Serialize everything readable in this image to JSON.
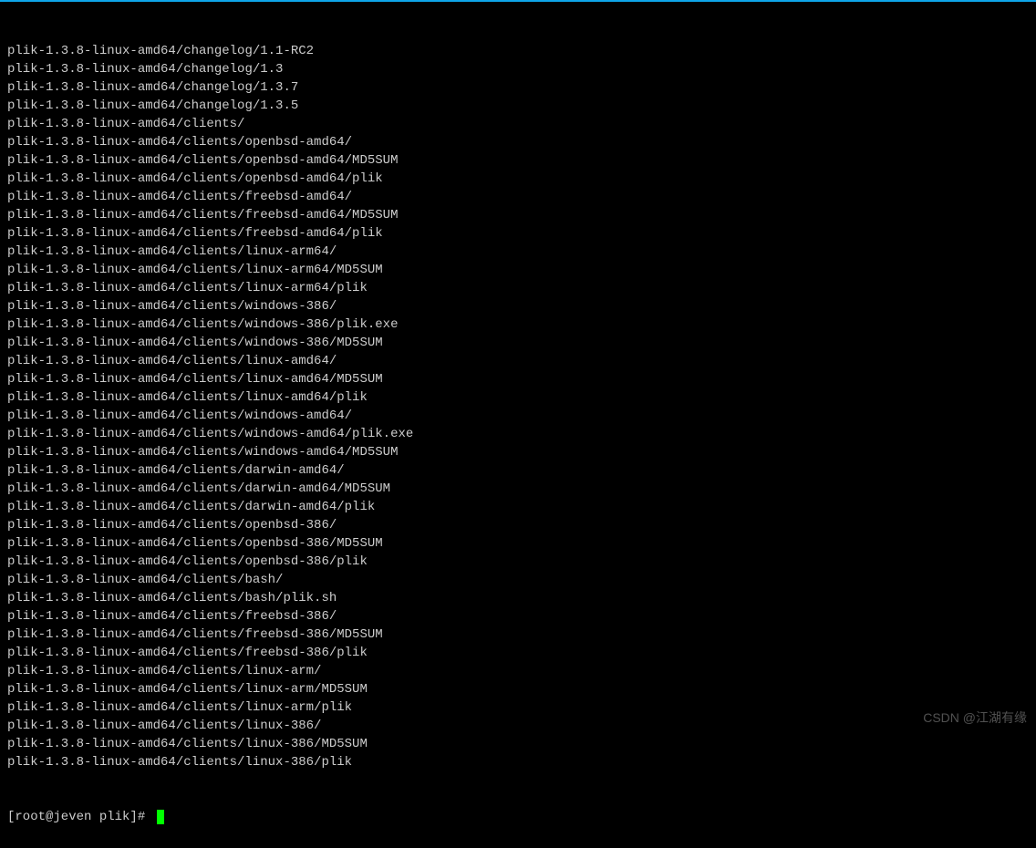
{
  "lines": [
    "plik-1.3.8-linux-amd64/changelog/1.1-RC2",
    "plik-1.3.8-linux-amd64/changelog/1.3",
    "plik-1.3.8-linux-amd64/changelog/1.3.7",
    "plik-1.3.8-linux-amd64/changelog/1.3.5",
    "plik-1.3.8-linux-amd64/clients/",
    "plik-1.3.8-linux-amd64/clients/openbsd-amd64/",
    "plik-1.3.8-linux-amd64/clients/openbsd-amd64/MD5SUM",
    "plik-1.3.8-linux-amd64/clients/openbsd-amd64/plik",
    "plik-1.3.8-linux-amd64/clients/freebsd-amd64/",
    "plik-1.3.8-linux-amd64/clients/freebsd-amd64/MD5SUM",
    "plik-1.3.8-linux-amd64/clients/freebsd-amd64/plik",
    "plik-1.3.8-linux-amd64/clients/linux-arm64/",
    "plik-1.3.8-linux-amd64/clients/linux-arm64/MD5SUM",
    "plik-1.3.8-linux-amd64/clients/linux-arm64/plik",
    "plik-1.3.8-linux-amd64/clients/windows-386/",
    "plik-1.3.8-linux-amd64/clients/windows-386/plik.exe",
    "plik-1.3.8-linux-amd64/clients/windows-386/MD5SUM",
    "plik-1.3.8-linux-amd64/clients/linux-amd64/",
    "plik-1.3.8-linux-amd64/clients/linux-amd64/MD5SUM",
    "plik-1.3.8-linux-amd64/clients/linux-amd64/plik",
    "plik-1.3.8-linux-amd64/clients/windows-amd64/",
    "plik-1.3.8-linux-amd64/clients/windows-amd64/plik.exe",
    "plik-1.3.8-linux-amd64/clients/windows-amd64/MD5SUM",
    "plik-1.3.8-linux-amd64/clients/darwin-amd64/",
    "plik-1.3.8-linux-amd64/clients/darwin-amd64/MD5SUM",
    "plik-1.3.8-linux-amd64/clients/darwin-amd64/plik",
    "plik-1.3.8-linux-amd64/clients/openbsd-386/",
    "plik-1.3.8-linux-amd64/clients/openbsd-386/MD5SUM",
    "plik-1.3.8-linux-amd64/clients/openbsd-386/plik",
    "plik-1.3.8-linux-amd64/clients/bash/",
    "plik-1.3.8-linux-amd64/clients/bash/plik.sh",
    "plik-1.3.8-linux-amd64/clients/freebsd-386/",
    "plik-1.3.8-linux-amd64/clients/freebsd-386/MD5SUM",
    "plik-1.3.8-linux-amd64/clients/freebsd-386/plik",
    "plik-1.3.8-linux-amd64/clients/linux-arm/",
    "plik-1.3.8-linux-amd64/clients/linux-arm/MD5SUM",
    "plik-1.3.8-linux-amd64/clients/linux-arm/plik",
    "plik-1.3.8-linux-amd64/clients/linux-386/",
    "plik-1.3.8-linux-amd64/clients/linux-386/MD5SUM",
    "plik-1.3.8-linux-amd64/clients/linux-386/plik"
  ],
  "prompt": "[root@jeven plik]# ",
  "watermark": "CSDN @江湖有缘"
}
